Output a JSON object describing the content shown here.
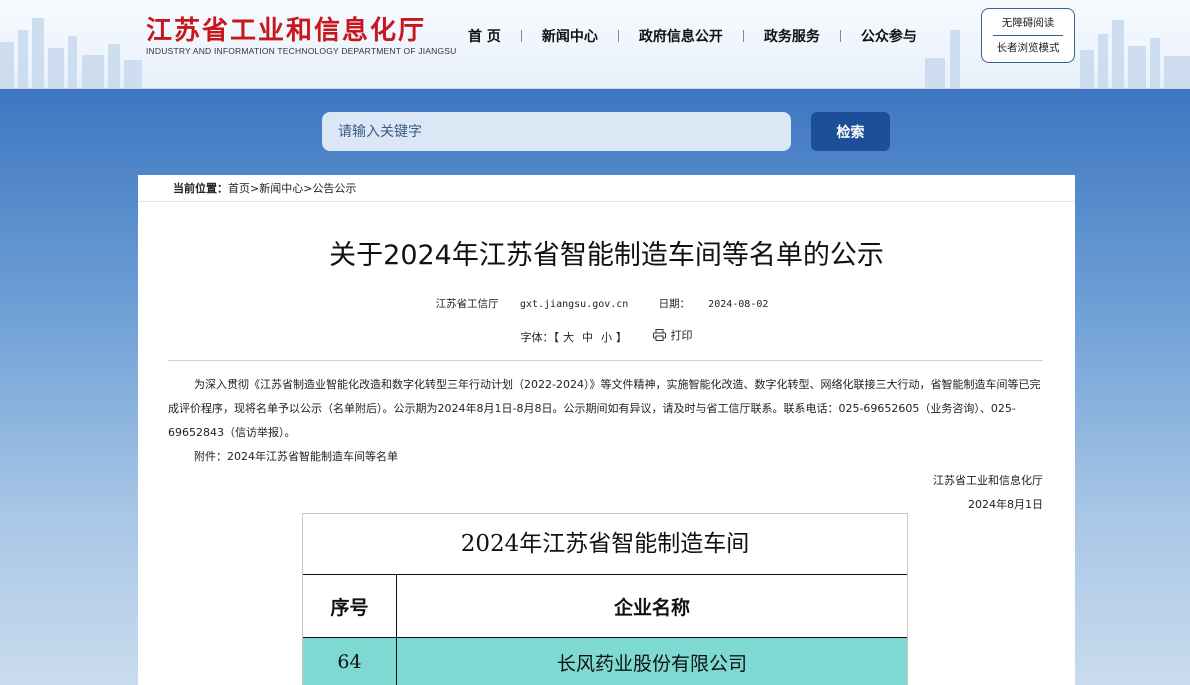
{
  "site": {
    "title": "江苏省工业和信息化厅",
    "subtitle": "INDUSTRY AND INFORMATION TECHNOLOGY DEPARTMENT OF JIANGSU"
  },
  "nav": {
    "items": [
      {
        "label": "首 页"
      },
      {
        "label": "新闻中心"
      },
      {
        "label": "政府信息公开"
      },
      {
        "label": "政务服务"
      },
      {
        "label": "公众参与"
      }
    ]
  },
  "accessibility": {
    "barrier_free": "无障碍阅读",
    "elder_mode": "长者浏览模式"
  },
  "search": {
    "placeholder": "请输入关键字",
    "button": "检索"
  },
  "breadcrumb": {
    "label": "当前位置：",
    "path": "首页>新闻中心>公告公示"
  },
  "article": {
    "title": "关于2024年江苏省智能制造车间等名单的公示",
    "source": "江苏省工信厅",
    "url": "gxt.jiangsu.gov.cn",
    "date_label": "日期：",
    "date": "2024-08-02",
    "font_label": "字体：【",
    "font_large": "大",
    "font_medium": "中",
    "font_small": "小",
    "font_close": "】",
    "print": "打印",
    "paragraph1": "为深入贯彻《江苏省制造业智能化改造和数字化转型三年行动计划（2022-2024）》等文件精神，实施智能化改造、数字化转型、网络化联接三大行动，省智能制造车间等已完成评价程序，现将名单予以公示（名单附后）。公示期为2024年8月1日-8月8日。公示期间如有异议，请及时与省工信厅联系。联系电话：025-69652605（业务咨询）、025-69652843（信访举报）。",
    "attachment": "附件：2024年江苏省智能制造车间等名单",
    "signature": "江苏省工业和信息化厅",
    "sign_date": "2024年8月1日"
  },
  "table": {
    "title": "2024年江苏省智能制造车间",
    "col_no": "序号",
    "col_name": "企业名称",
    "rows": [
      {
        "no": "64",
        "name": "长风药业股份有限公司"
      }
    ]
  },
  "colors": {
    "brand_red": "#c8161d",
    "search_button": "#1c4f97",
    "row_highlight": "#7dd9d2"
  }
}
